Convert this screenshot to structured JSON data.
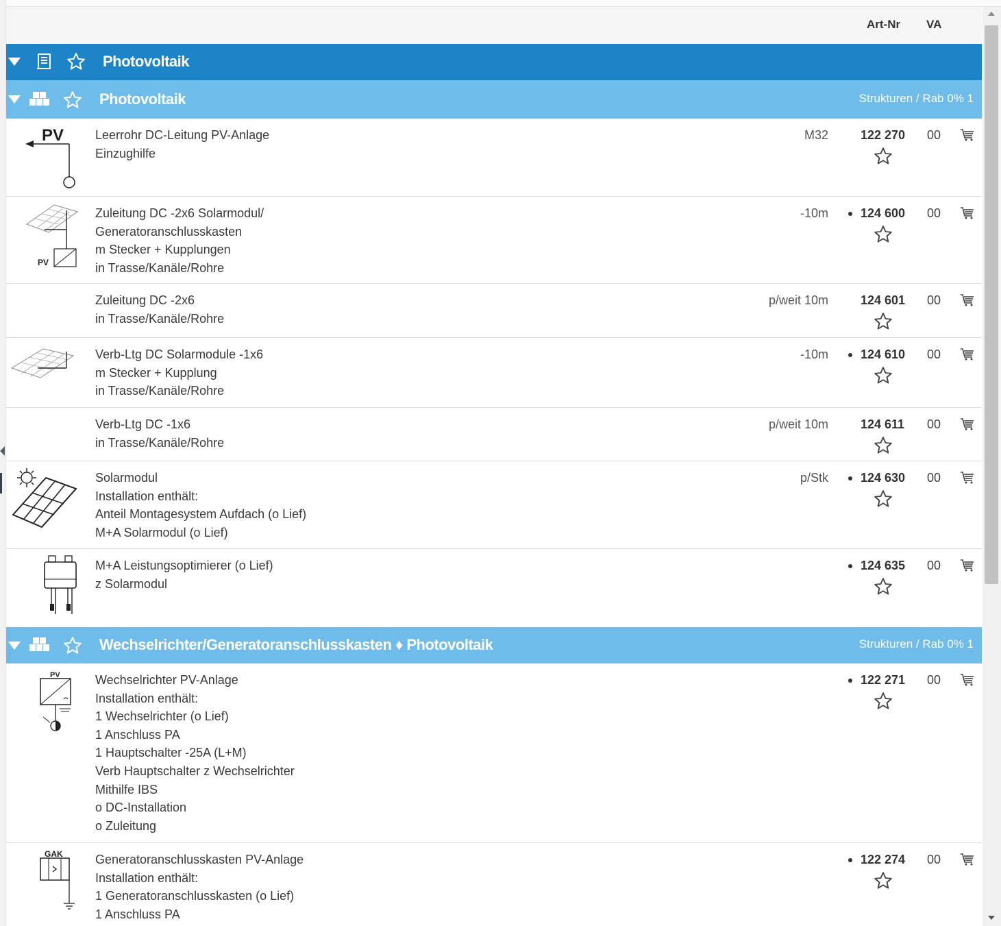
{
  "columns": {
    "art_nr": "Art-Nr",
    "va": "VA"
  },
  "section": {
    "title": "Photovoltaik",
    "icon": "catalog-book-icon"
  },
  "groups": [
    {
      "title": "Photovoltaik",
      "info": "Strukturen / Rab 0% 1",
      "items": [
        {
          "lines": [
            "Leerrohr DC-Leitung PV-Anlage",
            "Einzughilfe"
          ],
          "unit": "M32",
          "art": "122 270",
          "va": "00",
          "dot": false,
          "pic": "pv-conduit-icon"
        },
        {
          "lines": [
            "Zuleitung DC -2x6 Solarmodul/",
            "Generatoranschlusskasten",
            "m Stecker + Kupplungen",
            "in Trasse/Kanäle/Rohre"
          ],
          "unit": "-10m",
          "art": "124 600",
          "va": "00",
          "dot": true,
          "pic": "solar-to-inverter-icon"
        },
        {
          "lines": [
            "Zuleitung DC -2x6",
            "in Trasse/Kanäle/Rohre"
          ],
          "unit": "p/weit 10m",
          "art": "124 601",
          "va": "00",
          "dot": false,
          "pic": ""
        },
        {
          "lines": [
            "Verb-Ltg DC Solarmodule -1x6",
            "m Stecker + Kupplung",
            "in Trasse/Kanäle/Rohre"
          ],
          "unit": "-10m",
          "art": "124 610",
          "va": "00",
          "dot": true,
          "pic": "solar-module-link-icon"
        },
        {
          "lines": [
            "Verb-Ltg DC -1x6",
            "in Trasse/Kanäle/Rohre"
          ],
          "unit": "p/weit 10m",
          "art": "124 611",
          "va": "00",
          "dot": false,
          "pic": ""
        },
        {
          "lines": [
            "Solarmodul",
            "Installation enthält:",
            "Anteil Montagesystem Aufdach (o Lief)",
            "M+A Solarmodul (o Lief)"
          ],
          "unit": "p/Stk",
          "art": "124 630",
          "va": "00",
          "dot": true,
          "pic": "solar-panel-sun-icon"
        },
        {
          "lines": [
            "M+A Leistungsoptimierer (o Lief)",
            "z Solarmodul"
          ],
          "unit": "",
          "art": "124 635",
          "va": "00",
          "dot": true,
          "pic": "power-optimizer-icon"
        }
      ]
    },
    {
      "title": "Wechselrichter/Generatoranschlusskasten ♦ Photovoltaik",
      "info": "Strukturen / Rab 0% 1",
      "items": [
        {
          "lines": [
            "Wechselrichter PV-Anlage",
            "Installation enthält:",
            "1 Wechselrichter (o Lief)",
            "1 Anschluss PA",
            "1 Hauptschalter -25A (L+M)",
            "Verb Hauptschalter z Wechselrichter",
            "Mithilfe IBS",
            "o DC-Installation",
            "o Zuleitung"
          ],
          "unit": "",
          "art": "122 271",
          "va": "00",
          "dot": true,
          "pic": "pv-inverter-icon"
        },
        {
          "lines": [
            "Generatoranschlusskasten PV-Anlage",
            "Installation enthält:",
            "1 Generatoranschlusskasten (o Lief)",
            "1 Anschluss PA"
          ],
          "unit": "",
          "art": "122 274",
          "va": "00",
          "dot": true,
          "pic": "generator-junction-box-icon"
        }
      ]
    }
  ],
  "icon_labels": {
    "pv": "PV",
    "gak": "GAK"
  }
}
